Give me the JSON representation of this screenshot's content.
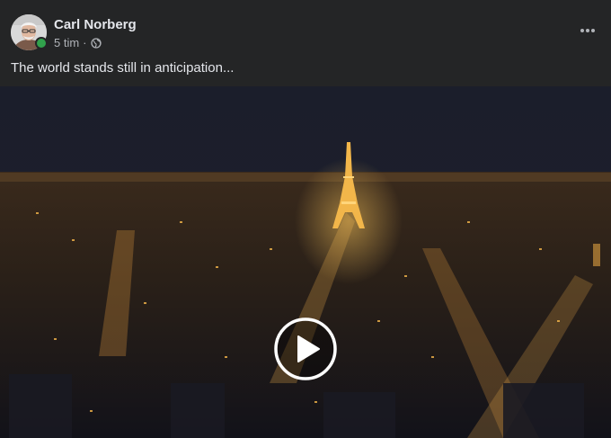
{
  "post": {
    "author": "Carl Norberg",
    "timestamp": "5 tim",
    "separator": "·",
    "audience_icon": "globe-icon",
    "caption": "The world stands still in anticipation...",
    "online": true
  },
  "icons": {
    "more": "more-horizontal-icon",
    "play": "play-icon"
  },
  "colors": {
    "background": "#242526",
    "text_primary": "#e4e6eb",
    "text_secondary": "#b0b3b8",
    "online": "#31a24c"
  }
}
